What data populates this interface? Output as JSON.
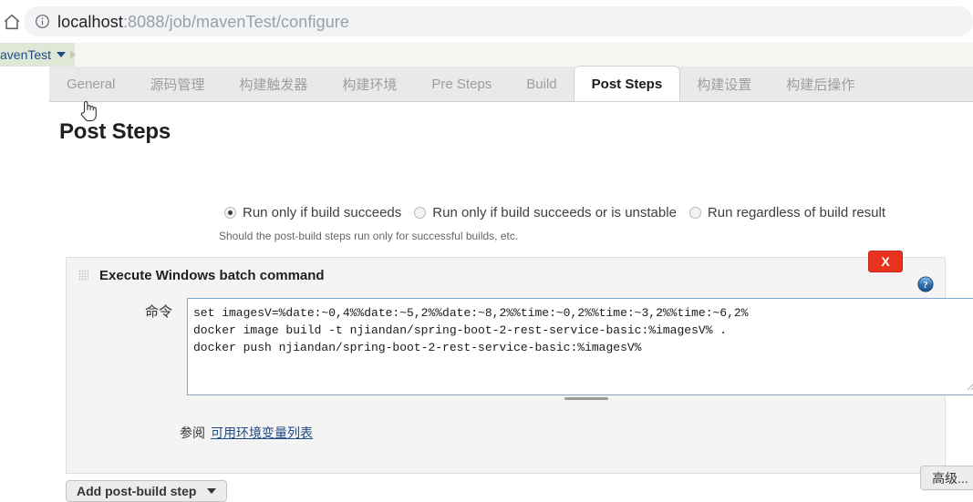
{
  "browser": {
    "home_icon": "home-icon",
    "info_icon": "info-icon",
    "url_host": "localhost",
    "url_path": ":8088/job/mavenTest/configure",
    "url_full": "localhost:8088/job/mavenTest/configure"
  },
  "breadcrumb": {
    "project": "avenTest",
    "caret_icon": "chevron-down-icon",
    "separator_icon": "chevron-right-icon"
  },
  "tabs": [
    {
      "label": "General",
      "active": false
    },
    {
      "label": "源码管理",
      "active": false
    },
    {
      "label": "构建触发器",
      "active": false
    },
    {
      "label": "构建环境",
      "active": false
    },
    {
      "label": "Pre Steps",
      "active": false
    },
    {
      "label": "Build",
      "active": false
    },
    {
      "label": "Post Steps",
      "active": true
    },
    {
      "label": "构建设置",
      "active": false
    },
    {
      "label": "构建后操作",
      "active": false
    }
  ],
  "main": {
    "page_title": "Post Steps",
    "radios": [
      {
        "label": "Run only if build succeeds",
        "checked": true
      },
      {
        "label": "Run only if build succeeds or is unstable",
        "checked": false
      },
      {
        "label": "Run regardless of build result",
        "checked": false
      }
    ],
    "radio_help": "Should the post-build steps run only for successful builds, etc.",
    "builder": {
      "title": "Execute Windows batch command",
      "drag_handle_icon": "drag-grip-icon",
      "delete_label": "X",
      "help_icon": "question-mark-icon",
      "command_label": "命令",
      "command_value": "set imagesV=%date:~0,4%%date:~5,2%%date:~8,2%%time:~0,2%%time:~3,2%%time:~6,2%\ndocker image build -t njiandan/spring-boot-2-rest-service-basic:%imagesV% .\ndocker push njiandan/spring-boot-2-rest-service-basic:%imagesV%",
      "see_also_prefix": "参阅",
      "see_also_link": "可用环境变量列表",
      "advanced_label": "高级..."
    },
    "add_post_build_step": "Add post-build step",
    "add_caret_icon": "caret-down-icon"
  },
  "colors": {
    "accent_blue": "#204a87",
    "delete_red": "#e8341f",
    "focus_border": "#7aa7d4",
    "panel_bg": "#f4f4f4",
    "tabbar_bg": "#e9e9e9",
    "breadcrumb_bg": "#f4f8f0"
  }
}
